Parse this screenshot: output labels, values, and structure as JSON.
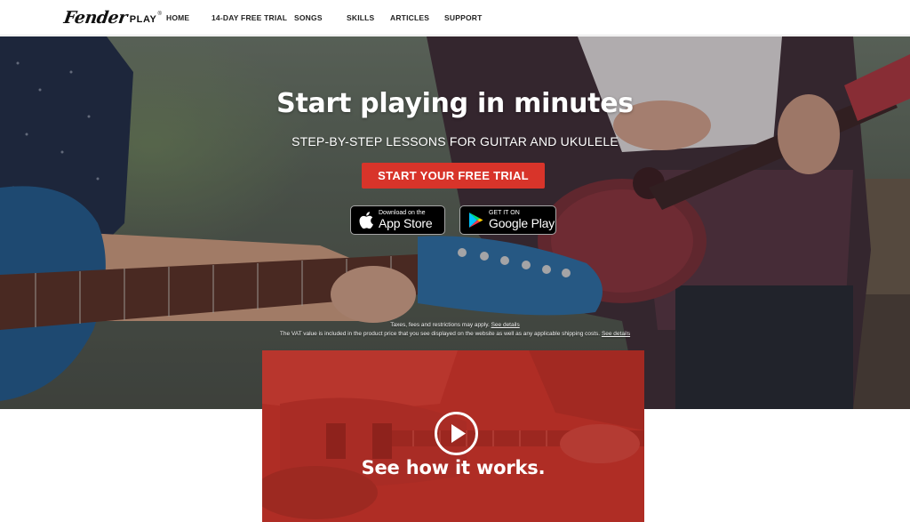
{
  "brand": {
    "logo_script": "Fender",
    "logo_play": "PLAY",
    "logo_tm": "®"
  },
  "nav": {
    "items": [
      {
        "label": "HOME"
      },
      {
        "label": "14-DAY FREE TRIAL"
      },
      {
        "label": "SONGS"
      },
      {
        "label": "SKILLS"
      },
      {
        "label": "ARTICLES"
      },
      {
        "label": "SUPPORT"
      }
    ]
  },
  "hero": {
    "title": "Start playing in minutes",
    "subtitle": "STEP-BY-STEP LESSONS FOR GUITAR AND UKULELE",
    "cta_label": "START YOUR FREE TRIAL",
    "app_store": {
      "small": "Download on the",
      "big": "App Store",
      "icon": "apple-icon"
    },
    "google_play": {
      "small": "GET IT ON",
      "big": "Google Play",
      "icon": "google-play-icon"
    },
    "legal_line1": "Taxes, fees and restrictions may apply.",
    "legal_line1_link": "See details",
    "legal_line2": "The VAT value is included in the product price that you see displayed on the website as well as any applicable shipping costs.",
    "legal_line2_link": "See details"
  },
  "video": {
    "caption": "See how it works.",
    "icon": "play-icon"
  },
  "colors": {
    "accent_red": "#d8342a",
    "video_red": "#b7342b",
    "header_bg": "#ffffff"
  }
}
